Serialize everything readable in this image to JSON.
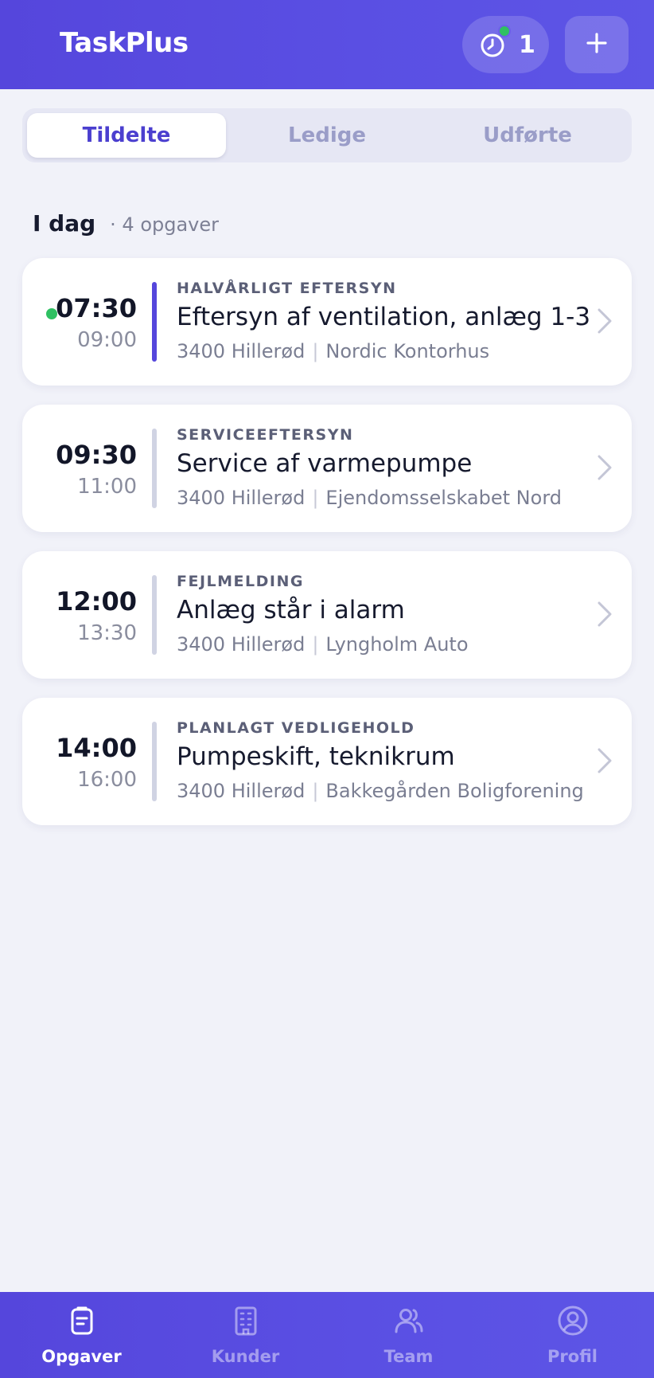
{
  "header": {
    "title": "TaskPlus",
    "timer_count": "1",
    "timer_icon": "clock-icon",
    "add_icon": "plus-icon"
  },
  "tabs": [
    {
      "label": "Tildelte",
      "active": true
    },
    {
      "label": "Ledige",
      "active": false
    },
    {
      "label": "Udførte",
      "active": false
    }
  ],
  "section": {
    "title": "I dag",
    "count": "· 4 opgaver"
  },
  "tasks": [
    {
      "start": "07:30",
      "end": "09:00",
      "category": "HALVÅRLIGT EFTERSYN",
      "title": "Eftersyn af ventilation, anlæg 1-3",
      "city": "3400 Hillerød",
      "customer": "Nordic Kontorhus",
      "in_progress": true
    },
    {
      "start": "09:30",
      "end": "11:00",
      "category": "SERVICEEFTERSYN",
      "title": "Service af varmepumpe",
      "city": "3400 Hillerød",
      "customer": "Ejendomsselskabet Nord",
      "in_progress": false
    },
    {
      "start": "12:00",
      "end": "13:30",
      "category": "FEJLMELDING",
      "title": "Anlæg står i alarm",
      "city": "3400 Hillerød",
      "customer": "Lyngholm Auto",
      "in_progress": false
    },
    {
      "start": "14:00",
      "end": "16:00",
      "category": "PLANLAGT VEDLIGEHOLD",
      "title": "Pumpeskift, teknikrum",
      "city": "3400 Hillerød",
      "customer": "Bakkegården Boligforening",
      "in_progress": false
    }
  ],
  "bottom_nav": [
    {
      "label": "Opgaver",
      "icon": "clipboard-icon",
      "active": true
    },
    {
      "label": "Kunder",
      "icon": "building-icon",
      "active": false
    },
    {
      "label": "Team",
      "icon": "users-icon",
      "active": false
    },
    {
      "label": "Profil",
      "icon": "user-circle-icon",
      "active": false
    }
  ],
  "colors": {
    "brand": "#5546dc",
    "status_green": "#2fc062",
    "background": "#f1f2f9"
  }
}
